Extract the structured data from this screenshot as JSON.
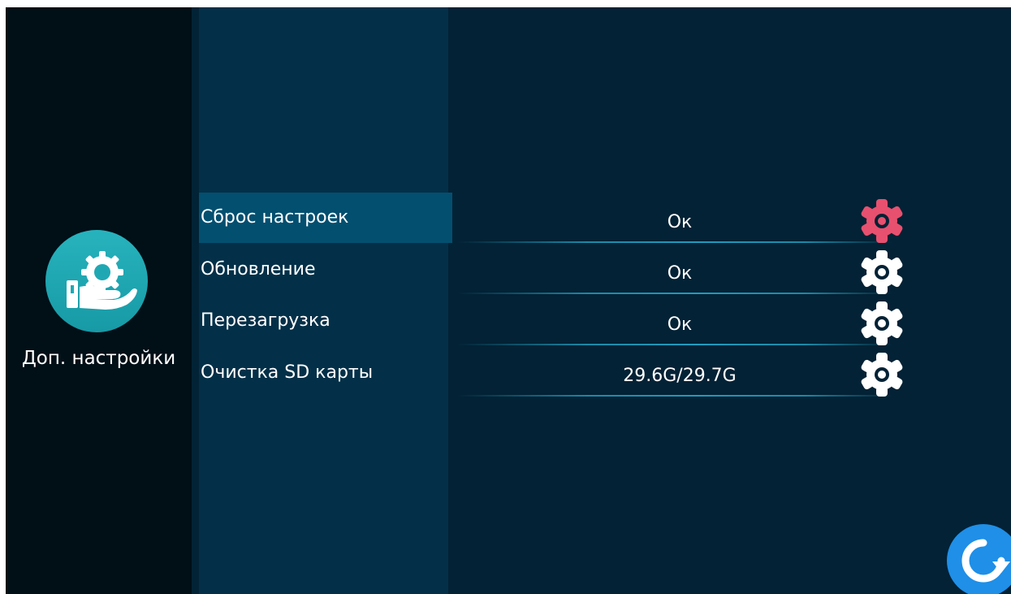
{
  "sidebar": {
    "title": "Доп. настройки",
    "icon": "hand-gear-icon"
  },
  "rows": [
    {
      "label": "Сброс настроек",
      "value": "Ок",
      "selected": true,
      "gear_color": "#e8506f"
    },
    {
      "label": "Обновление",
      "value": "Ок",
      "selected": false,
      "gear_color": "#ffffff"
    },
    {
      "label": "Перезагрузка",
      "value": "Ок",
      "selected": false,
      "gear_color": "#ffffff"
    },
    {
      "label": "Очистка SD карты",
      "value": "29.6G/29.7G",
      "selected": false,
      "gear_color": "#ffffff"
    }
  ],
  "colors": {
    "background": "#032235",
    "sidebar": "#010f17",
    "menu_panel": "#033048",
    "selected_item": "#034f70",
    "accent_teal": "#1fa8b3",
    "accent_pink": "#e8506f",
    "refresh_blue": "#1f8fe8"
  },
  "refresh_button": {
    "icon": "refresh-icon"
  }
}
